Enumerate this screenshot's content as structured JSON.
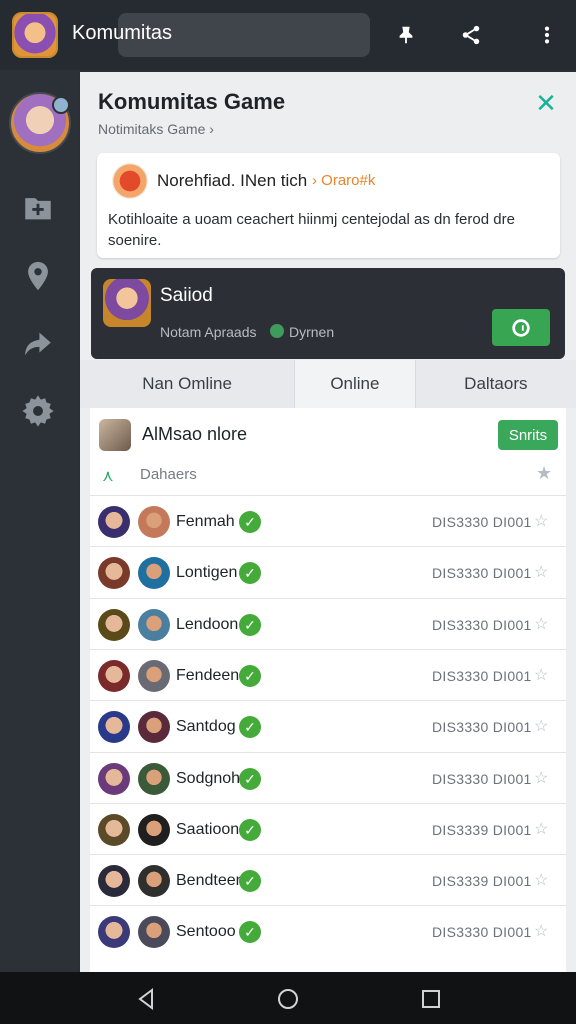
{
  "topbar": {
    "title": "Komumitas",
    "icons": [
      "app-icon",
      "pin-icon",
      "share-icon",
      "more-icon"
    ]
  },
  "sidebar": {
    "icons": [
      "profile-avatar",
      "add-folder-icon",
      "location-icon",
      "forward-icon",
      "settings-icon"
    ]
  },
  "panel": {
    "title": "Komumitas Game",
    "subtitle": "Notimitaks Game ›",
    "close_icon": "close-icon"
  },
  "info_card": {
    "name": "Norehfiad. INen tich",
    "tag": "› Oraro#k",
    "description": "Kotihloaite a uoam ceachert hiinmj centejodal as dn ferod dre soenire."
  },
  "dark_card": {
    "title": "Saiiod",
    "subtitle": "Notam Apraads",
    "status_text": "Dyrnen"
  },
  "tabs": [
    "Nan Omline",
    "Online",
    "Daltaors"
  ],
  "admin": {
    "name": "AlMsao nlore",
    "button_label": "Snrits"
  },
  "section": {
    "label": "Dahaers"
  },
  "members": [
    {
      "name": "Fenmah",
      "meta": "DIS3330 DI001"
    },
    {
      "name": "Lontigen",
      "meta": "DIS3330 DI001"
    },
    {
      "name": "Lendoon",
      "meta": "DIS3330 DI001"
    },
    {
      "name": "Fendeen",
      "meta": "DIS3330 DI001"
    },
    {
      "name": "Santdog",
      "meta": "DIS3330 DI001"
    },
    {
      "name": "Sodgnoh",
      "meta": "DIS3330 DI001"
    },
    {
      "name": "Saatioon",
      "meta": "DIS3339 DI001"
    },
    {
      "name": "Bendteen",
      "meta": "DIS3339 DI001"
    },
    {
      "name": "Sentooo",
      "meta": "DIS3330 DI001"
    }
  ],
  "colors": {
    "accent_teal": "#19b39a",
    "success_green": "#3aa85a",
    "tag_orange": "#e8842a",
    "dark_card": "#2c3036"
  }
}
